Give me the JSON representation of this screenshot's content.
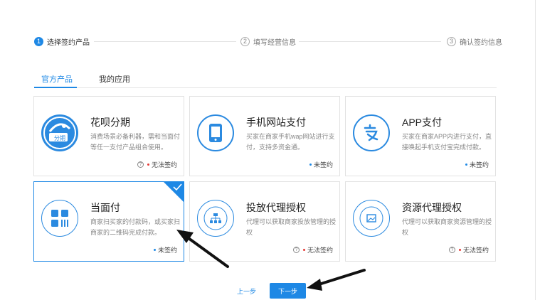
{
  "stepper": {
    "steps": [
      {
        "num": "1",
        "label": "选择签约产品"
      },
      {
        "num": "2",
        "label": "填写经营信息"
      },
      {
        "num": "3",
        "label": "确认签约信息"
      }
    ]
  },
  "tabs": [
    {
      "label": "官方产品"
    },
    {
      "label": "我的应用"
    }
  ],
  "products": [
    {
      "title": "花呗分期",
      "desc": "消费场景必备利器，需和当面付等任一支付产品组合使用。",
      "status": "无法签约",
      "icon_name": "huabei-installment-icon",
      "icon_text": "分期"
    },
    {
      "title": "手机网站支付",
      "desc": "买家在商家手机wap网站进行支付，支持多资金通。",
      "status": "未签约",
      "icon_name": "mobile-phone-icon"
    },
    {
      "title": "APP支付",
      "desc": "买家在商家APP内进行支付，直接唤起手机支付宝完成付款。",
      "status": "未签约",
      "icon_name": "alipay-icon"
    },
    {
      "title": "当面付",
      "desc": "商家扫买家的付款码，或买家扫商家的二维码完成付款。",
      "status": "未签约",
      "icon_name": "qr-code-icon"
    },
    {
      "title": "投放代理授权",
      "desc": "代理可以获取商家投放管理的授权",
      "status": "无法签约",
      "icon_name": "org-chart-icon"
    },
    {
      "title": "资源代理授权",
      "desc": "代理可以获取商家资源管理的授权",
      "status": "无法签约",
      "icon_name": "image-resource-icon"
    }
  ],
  "buttons": {
    "prev": "上一步",
    "next": "下一步"
  },
  "colors": {
    "accent": "#1e88e5",
    "error": "#e53935"
  }
}
